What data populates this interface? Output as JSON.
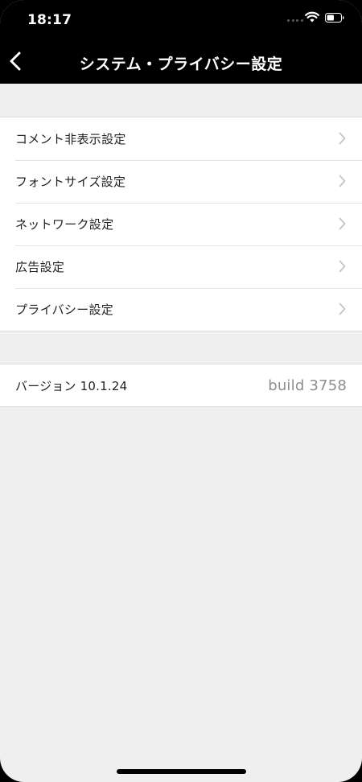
{
  "status_bar": {
    "time": "18:17"
  },
  "nav": {
    "title": "システム・プライバシー設定",
    "back_icon": "chevron-left-icon"
  },
  "settings": {
    "items": [
      {
        "label": "コメント非表示設定"
      },
      {
        "label": "フォントサイズ設定"
      },
      {
        "label": "ネットワーク設定"
      },
      {
        "label": "広告設定"
      },
      {
        "label": "プライバシー設定"
      }
    ]
  },
  "version": {
    "label": "バージョン 10.1.24",
    "build": "build 3758"
  },
  "colors": {
    "header_bg": "#000000",
    "page_bg": "#efefef",
    "row_bg": "#ffffff",
    "chevron": "#c4c4c4",
    "build_text": "#8e8e8e"
  }
}
